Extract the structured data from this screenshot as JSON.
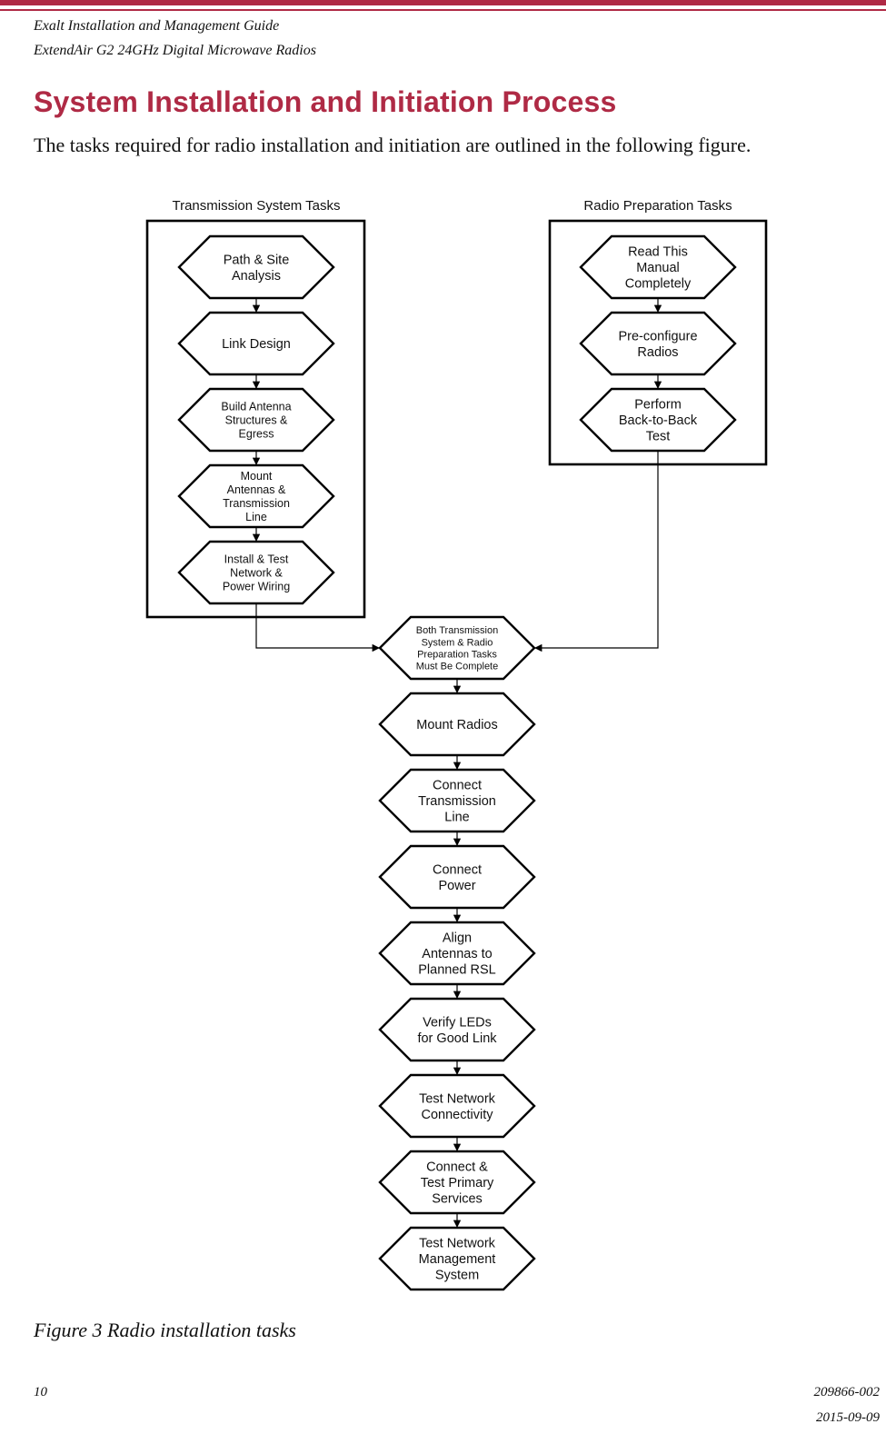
{
  "header": {
    "line1": "Exalt Installation and Management Guide",
    "line2": "ExtendAir G2 24GHz Digital Microwave Radios",
    "accent_color": "#AF2A45"
  },
  "section": {
    "title": "System Installation and Initiation Process",
    "intro": "The tasks required for radio installation and initiation are outlined in the following figure."
  },
  "diagram": {
    "groups": [
      {
        "label": "Transmission System Tasks",
        "nodes": [
          {
            "lines": [
              "Path & Site",
              "Analysis"
            ]
          },
          {
            "lines": [
              "Link Design"
            ]
          },
          {
            "lines": [
              "Build Antenna",
              "Structures &",
              "Egress"
            ]
          },
          {
            "lines": [
              "Mount",
              "Antennas &",
              "Transmission",
              "Line"
            ]
          },
          {
            "lines": [
              "Install & Test",
              "Network &",
              "Power Wiring"
            ]
          }
        ]
      },
      {
        "label": "Radio Preparation Tasks",
        "nodes": [
          {
            "lines": [
              "Read This",
              "Manual",
              "Completely"
            ]
          },
          {
            "lines": [
              "Pre-configure",
              "Radios"
            ]
          },
          {
            "lines": [
              "Perform",
              "Back-to-Back",
              "Test"
            ]
          }
        ]
      }
    ],
    "main_sequence": [
      {
        "lines": [
          "Both Transmission",
          "System & Radio",
          "Preparation Tasks",
          "Must Be Complete"
        ]
      },
      {
        "lines": [
          "Mount Radios"
        ]
      },
      {
        "lines": [
          "Connect",
          "Transmission",
          "Line"
        ]
      },
      {
        "lines": [
          "Connect",
          "Power"
        ]
      },
      {
        "lines": [
          "Align",
          "Antennas to",
          "Planned RSL"
        ]
      },
      {
        "lines": [
          "Verify LEDs",
          "for Good Link"
        ]
      },
      {
        "lines": [
          "Test Network",
          "Connectivity"
        ]
      },
      {
        "lines": [
          "Connect &",
          "Test Primary",
          "Services"
        ]
      },
      {
        "lines": [
          "Test Network",
          "Management",
          "System"
        ]
      }
    ]
  },
  "figure": {
    "caption": "Figure 3   Radio installation tasks"
  },
  "footer": {
    "page_number": "10",
    "doc_number": "209866-002",
    "date": "2015-09-09"
  }
}
